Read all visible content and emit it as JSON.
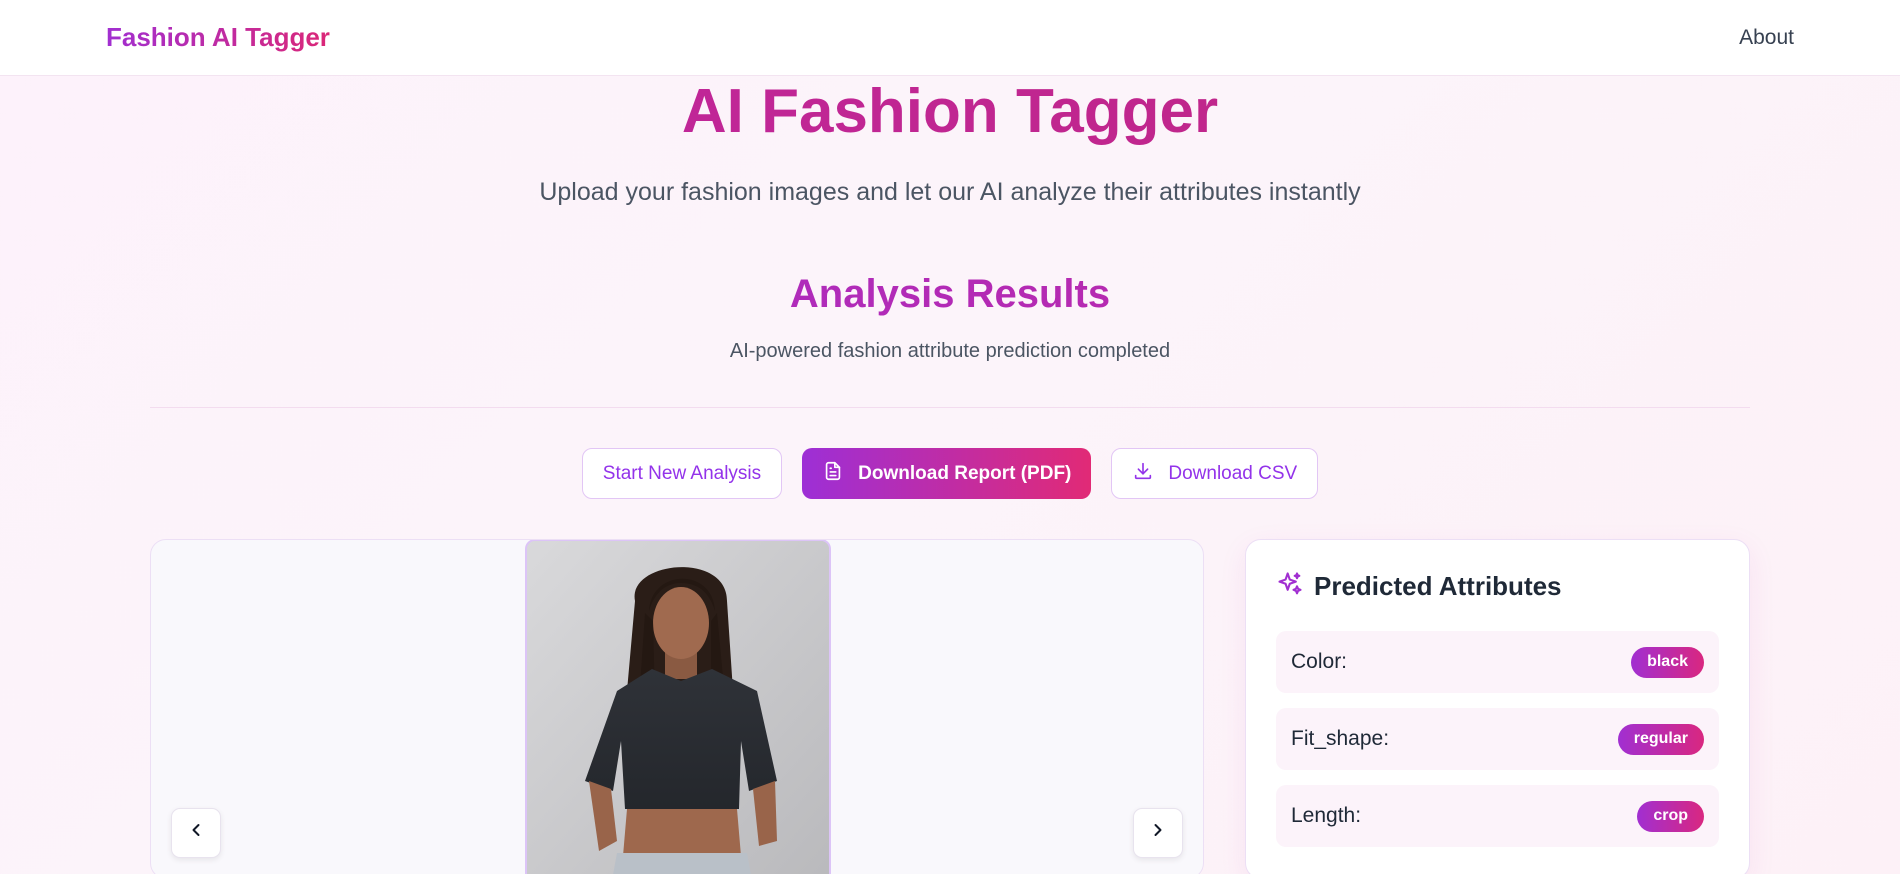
{
  "nav": {
    "brand": "Fashion AI Tagger",
    "about": "About"
  },
  "hero": {
    "title": "AI Fashion Tagger",
    "subtitle": "Upload your fashion images and let our AI analyze their attributes instantly"
  },
  "results": {
    "title": "Analysis Results",
    "subtitle": "AI-powered fashion attribute prediction completed"
  },
  "actions": {
    "start_new": "Start New Analysis",
    "download_pdf": "Download Report (PDF)",
    "download_csv": "Download CSV"
  },
  "carousel": {
    "prev_icon": "chevron-left-icon",
    "next_icon": "chevron-right-icon"
  },
  "attributes": {
    "title": "Predicted Attributes",
    "icon": "sparkles-icon",
    "items": [
      {
        "label": "Color:",
        "value": "black"
      },
      {
        "label": "Fit_shape:",
        "value": "regular"
      },
      {
        "label": "Length:",
        "value": "crop"
      }
    ]
  },
  "colors": {
    "brand_start": "#a12fd1",
    "brand_end": "#db2777",
    "accent_purple": "#9333ea"
  }
}
